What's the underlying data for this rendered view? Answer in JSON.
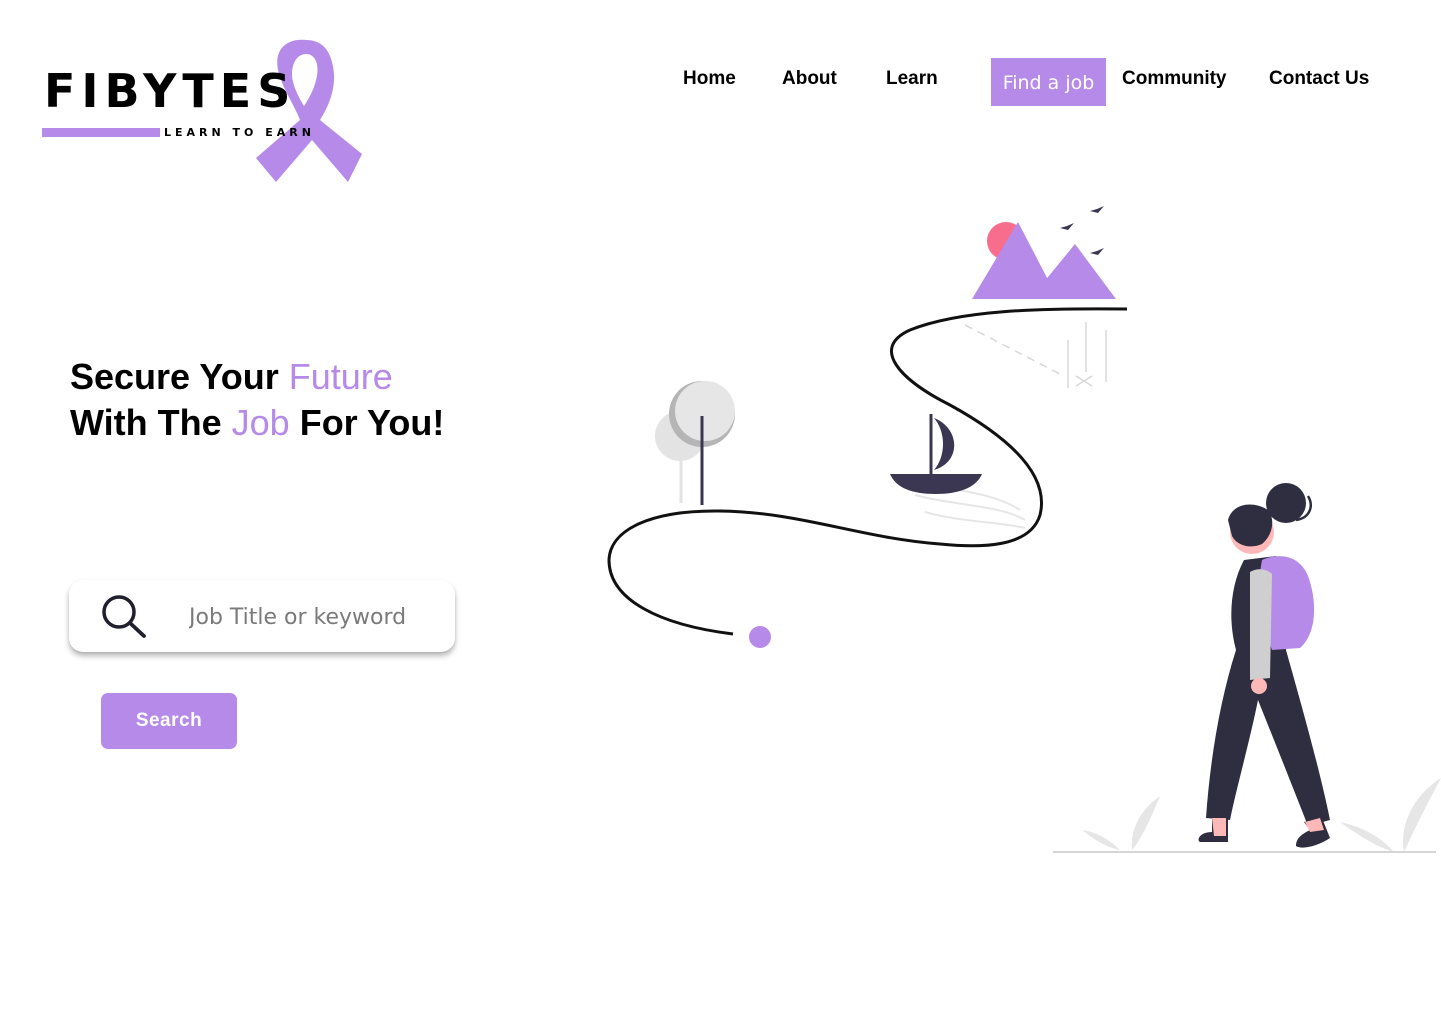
{
  "brand": {
    "name": "FIBYTES",
    "tagline": "LEARN TO EARN",
    "accent_color": "#b68ae9"
  },
  "nav": {
    "items": [
      {
        "label": "Home"
      },
      {
        "label": "About"
      },
      {
        "label": "Learn"
      },
      {
        "label": "Find a job",
        "active": true
      },
      {
        "label": "Community"
      },
      {
        "label": "Contact Us"
      }
    ]
  },
  "hero": {
    "line1_a": "Secure Your ",
    "line1_b": "Future",
    "line2_a": "With The ",
    "line2_b": "Job",
    "line2_c": " For You!"
  },
  "search": {
    "placeholder": "Job Title or keyword",
    "value": "",
    "button_label": "Search",
    "icon": "search-icon"
  },
  "illustration": {
    "icons": [
      "ribbon-icon",
      "mountain-icon",
      "sun-icon",
      "bird-icon",
      "tree-icon",
      "boat-icon",
      "woman-with-backpack-icon",
      "plant-icon",
      "path-end-dot-icon"
    ]
  }
}
